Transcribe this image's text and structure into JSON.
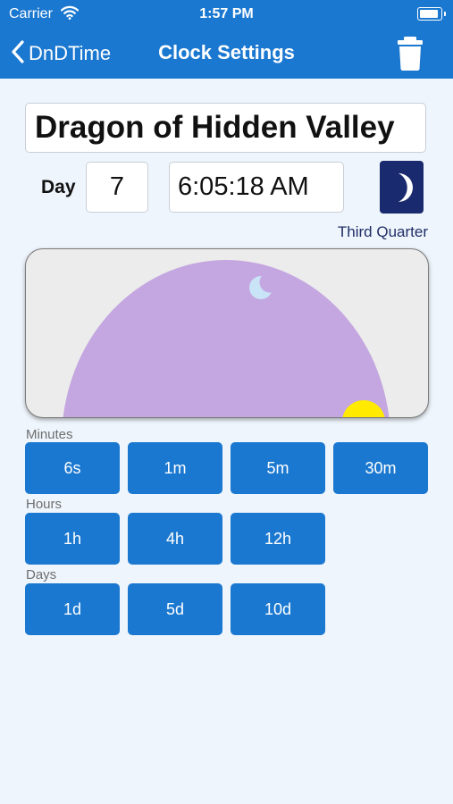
{
  "status": {
    "carrier": "Carrier",
    "time": "1:57 PM"
  },
  "nav": {
    "back_label": "DnDTime",
    "title": "Clock Settings"
  },
  "clock": {
    "name": "Dragon of Hidden Valley",
    "day_label": "Day",
    "day": "7",
    "time": "6:05:18 AM",
    "moon_phase": "Third Quarter"
  },
  "colors": {
    "bar": "#1b78d0",
    "sky_dome": "#c4a6e0",
    "sun": "#ffea00",
    "moon_badge": "#1a2a6e"
  },
  "increments": {
    "minutes": {
      "label": "Minutes",
      "buttons": [
        "6s",
        "1m",
        "5m",
        "30m"
      ]
    },
    "hours": {
      "label": "Hours",
      "buttons": [
        "1h",
        "4h",
        "12h"
      ]
    },
    "days": {
      "label": "Days",
      "buttons": [
        "1d",
        "5d",
        "10d"
      ]
    }
  }
}
